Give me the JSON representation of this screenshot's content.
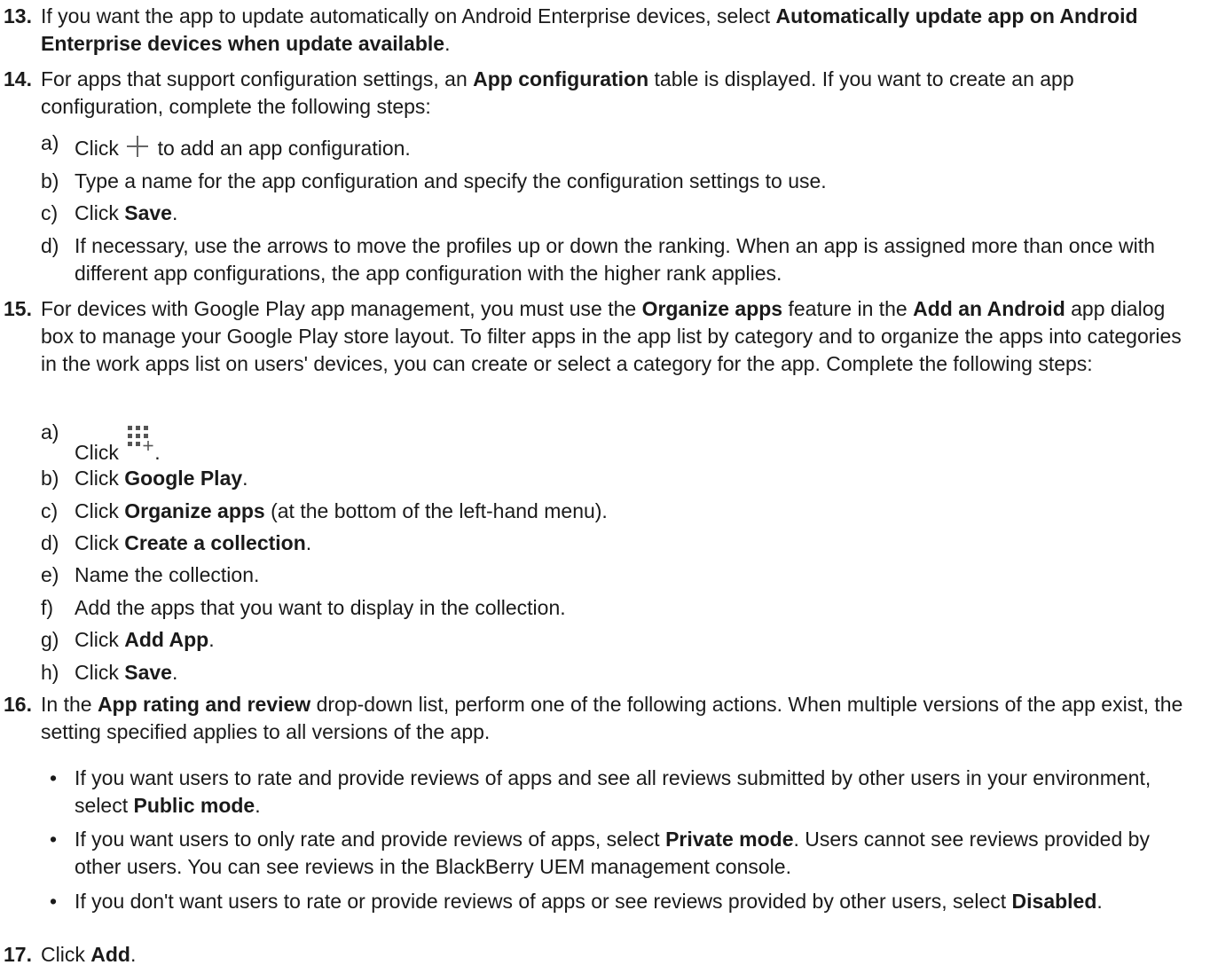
{
  "s13": {
    "num": "13.",
    "a": "If you want the app to update automatically on  Android Enterprise devices, select ",
    "b": "Automatically update app on Android Enterprise devices when update available",
    "c": "."
  },
  "s14": {
    "num": "14.",
    "a": "For apps that support configuration settings, an ",
    "b": "App configuration",
    "c": " table is displayed. If you want to create an app configuration, complete the following steps:",
    "sa": {
      "l": "a)",
      "a": "Click ",
      "b": " to add an app configuration."
    },
    "sb": {
      "l": "b)",
      "a": "Type a name for the app configuration and specify the configuration settings to use."
    },
    "sc": {
      "l": "c)",
      "a": "Click ",
      "b": "Save",
      "c": "."
    },
    "sd": {
      "l": "d)",
      "a": "If necessary, use the arrows to move the profiles up or down the ranking. When an app is assigned more than once with different app configurations, the app configuration with the higher rank applies."
    }
  },
  "s15": {
    "num": "15.",
    "a": "For devices with Google Play app management, you must use the ",
    "b": "Organize apps",
    "c": " feature in the ",
    "d": "Add an Android",
    "e": " app dialog box to manage your Google Play store layout. To filter apps in the app list by category and to organize the apps into categories in the work apps list on users' devices, you can create or select a category for the app. Complete the following steps:",
    "sa": {
      "l": "a)",
      "a": "Click ",
      "b": "."
    },
    "sb": {
      "l": "b)",
      "a": "Click ",
      "b": "Google Play",
      "c": "."
    },
    "sc": {
      "l": "c)",
      "a": "Click ",
      "b": "Organize apps",
      "c": " (at the bottom of the left-hand menu)."
    },
    "sd": {
      "l": "d)",
      "a": "Click ",
      "b": "Create a collection",
      "c": "."
    },
    "se": {
      "l": "e)",
      "a": "Name the collection."
    },
    "sf": {
      "l": "f)",
      "a": "Add the apps that you want to display in the collection."
    },
    "sg": {
      "l": "g)",
      "a": "Click ",
      "b": "Add App",
      "c": "."
    },
    "sh": {
      "l": "h)",
      "a": "Click ",
      "b": "Save",
      "c": "."
    }
  },
  "s16": {
    "num": "16.",
    "a": "In the ",
    "b": "App rating and review",
    "c": " drop-down list, perform one of the following actions. When multiple versions of the app exist, the setting specified applies to all versions of the app.",
    "bullet": "•",
    "b1": {
      "a": "If you want users to rate and provide reviews of apps and see all reviews submitted by other users in your environment, select ",
      "b": "Public mode",
      "c": "."
    },
    "b2": {
      "a": "If you want users to only rate and provide reviews of apps, select ",
      "b": "Private mode",
      "c": ". Users cannot see reviews provided by other users. You can see reviews in the BlackBerry UEM management console."
    },
    "b3": {
      "a": "If you don't want users to rate or provide reviews of apps or see reviews provided by other users, select ",
      "b": "Disabled",
      "c": "."
    }
  },
  "s17": {
    "num": "17.",
    "a": "Click ",
    "b": "Add",
    "c": "."
  },
  "icons": {
    "plus": "plus-icon",
    "grid": "grid-add-icon"
  }
}
